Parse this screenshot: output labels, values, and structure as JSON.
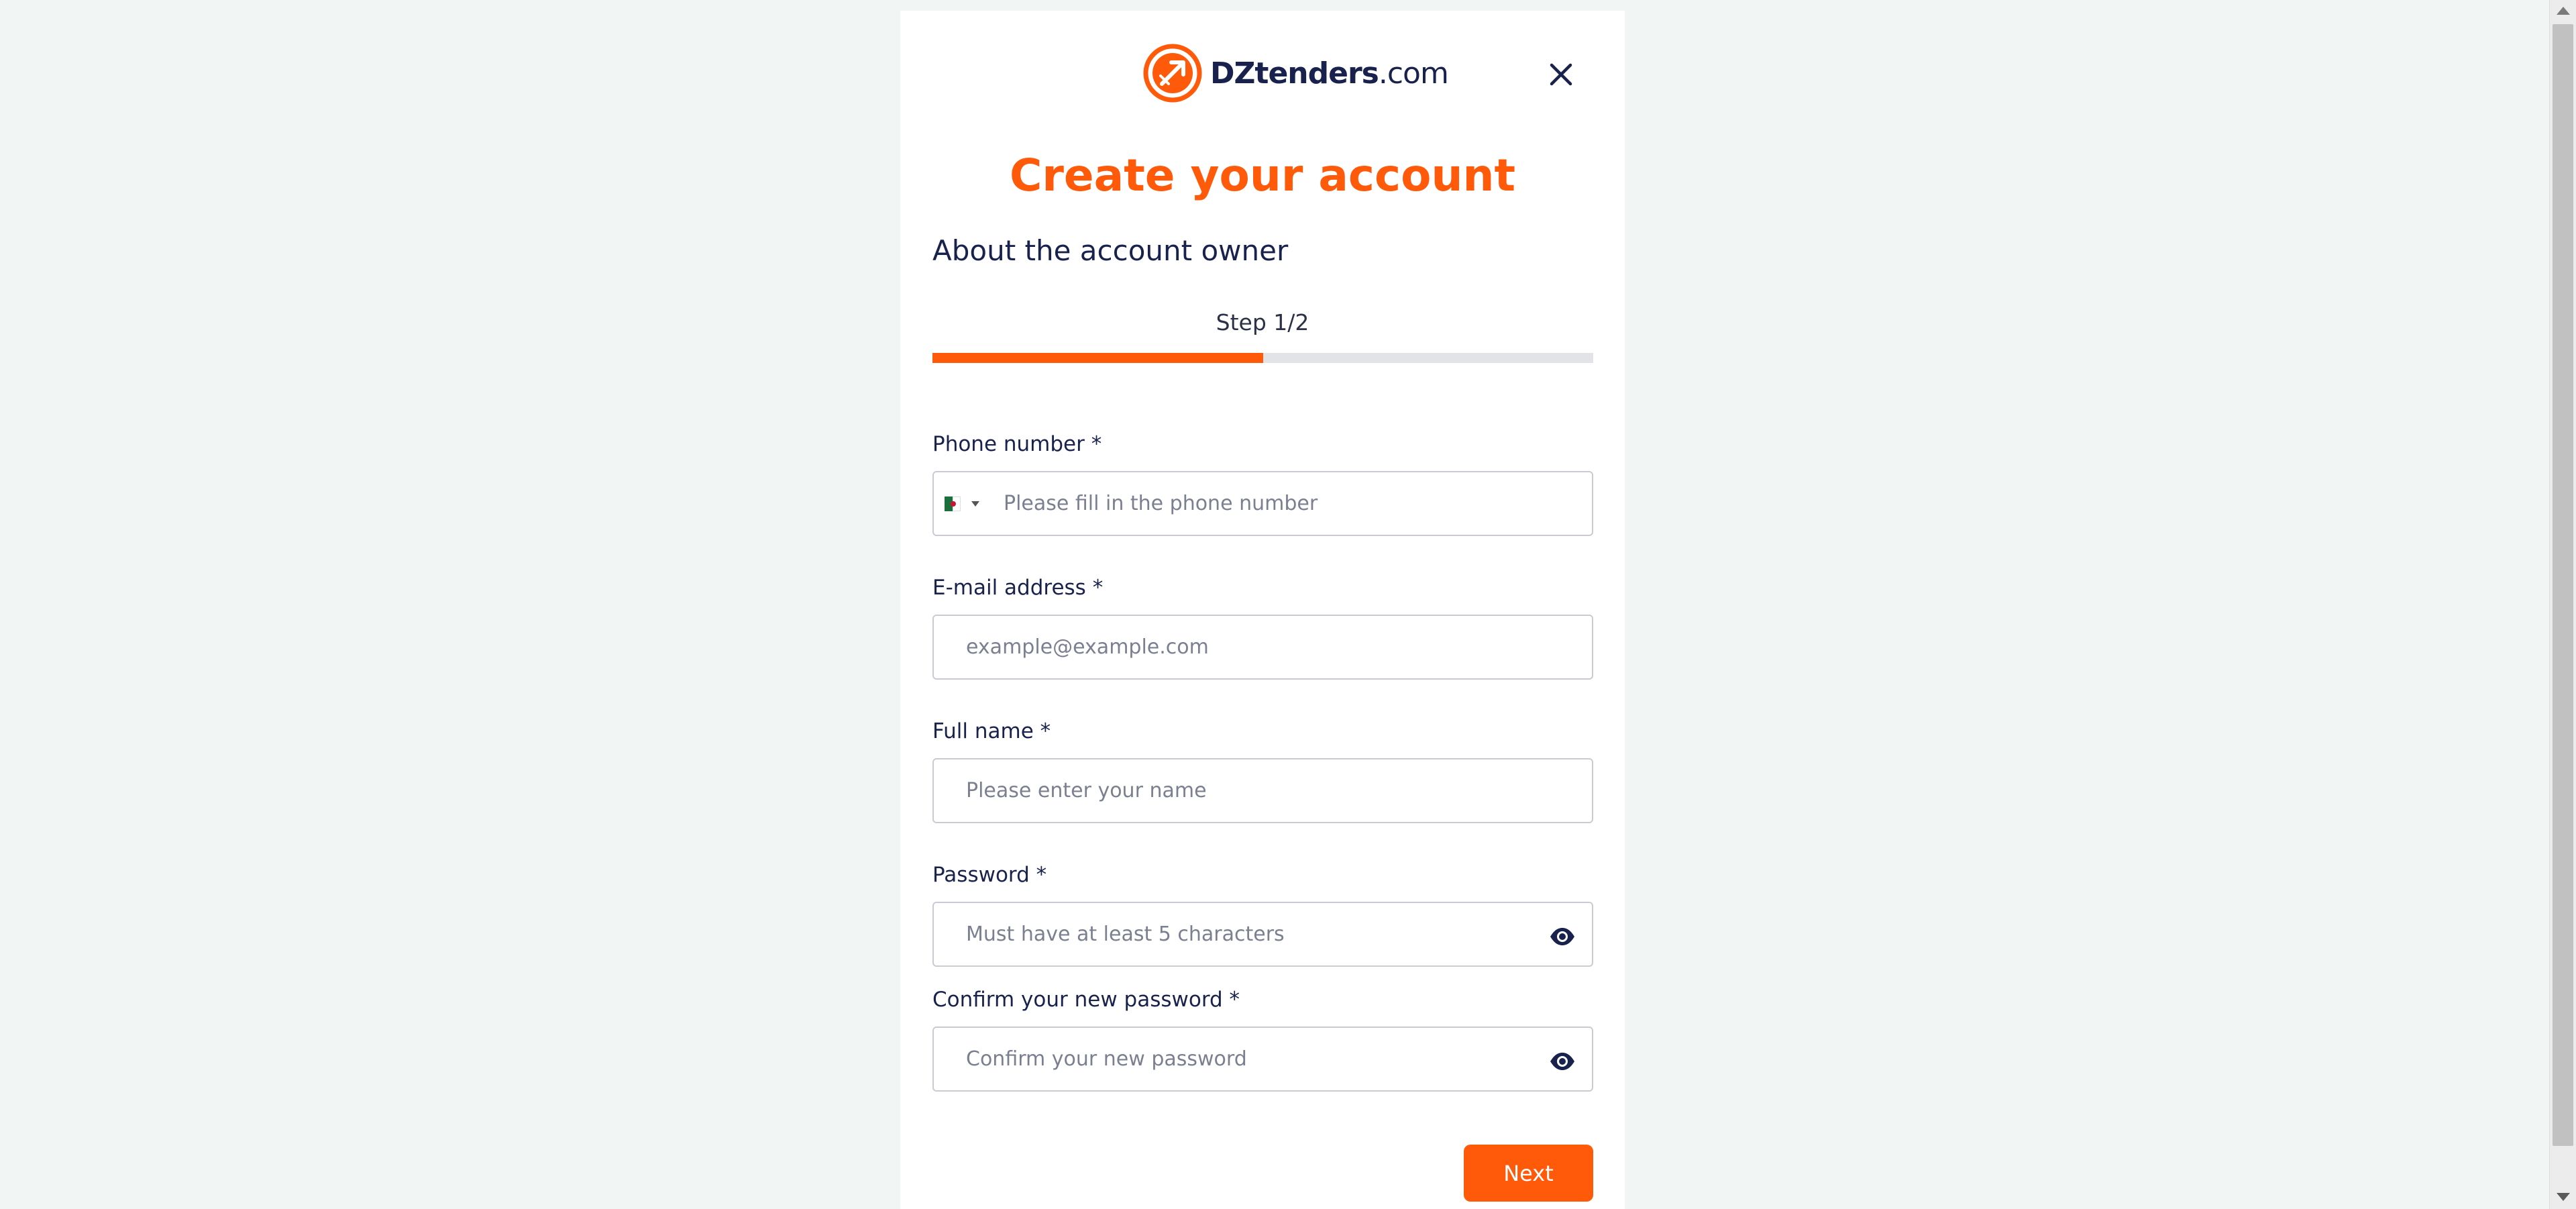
{
  "brand": {
    "logo_bold": "DZtenders",
    "logo_suffix": ".com",
    "accent_color": "#ff5a0a"
  },
  "modal": {
    "title": "Create your account",
    "section_title": "About the account owner",
    "step_text": "Step 1/2",
    "progress": 0.5
  },
  "form": {
    "phone": {
      "label": "Phone number *",
      "placeholder": "Please fill in the phone number",
      "country_flag": "algeria-flag-icon"
    },
    "email": {
      "label": "E-mail address *",
      "placeholder": "example@example.com"
    },
    "full_name": {
      "label": "Full name *",
      "placeholder": "Please enter your name"
    },
    "password": {
      "label": "Password *",
      "placeholder": "Must have at least 5 characters"
    },
    "confirm_password": {
      "label": "Confirm your new password *",
      "placeholder": "Confirm your new password"
    },
    "next_label": "Next"
  },
  "icons": {
    "close": "close-icon",
    "eye": "eye-icon",
    "caret": "chevron-down-icon"
  }
}
